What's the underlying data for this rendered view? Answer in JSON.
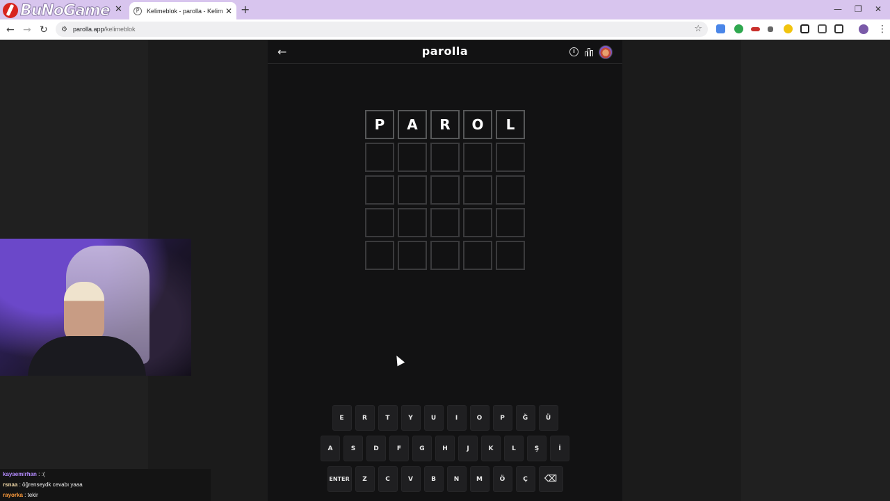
{
  "browser": {
    "logo_text": "BuNoGame",
    "active_tab_title": "Kelimeblok - parolla - Kelime o",
    "url_domain": "parolla.app",
    "url_path": "/kelimeblok",
    "new_tab": "+",
    "tab_close": "✕"
  },
  "game": {
    "title": "parolla",
    "back": "←",
    "info": "i",
    "board": [
      [
        "P",
        "A",
        "R",
        "O",
        "L"
      ],
      [
        "",
        "",
        "",
        "",
        ""
      ],
      [
        "",
        "",
        "",
        "",
        ""
      ],
      [
        "",
        "",
        "",
        "",
        ""
      ],
      [
        "",
        "",
        "",
        "",
        ""
      ]
    ],
    "keyboard": {
      "row1": [
        "E",
        "R",
        "T",
        "Y",
        "U",
        "I",
        "O",
        "P",
        "Ğ",
        "Ü"
      ],
      "row2": [
        "A",
        "S",
        "D",
        "F",
        "G",
        "H",
        "J",
        "K",
        "L",
        "Ş",
        "İ"
      ],
      "row3": [
        "ENTER",
        "Z",
        "C",
        "V",
        "B",
        "N",
        "M",
        "Ö",
        "Ç",
        "⌫"
      ]
    }
  },
  "chat": [
    {
      "user": "kayaemirhan",
      "color": "#b58cff",
      "message": ":("
    },
    {
      "user": "rsnaa",
      "color": "#f0d8a8",
      "message": "öğrenseydk cevabı yaaa"
    },
    {
      "user": "rayorka",
      "color": "#ff9c3c",
      "message": "tekir"
    }
  ],
  "colors": {
    "background": "#121213",
    "tile_border": "#3a3a3c",
    "key_bg": "#1f1f21",
    "tabbar": "#d8c5ee"
  }
}
